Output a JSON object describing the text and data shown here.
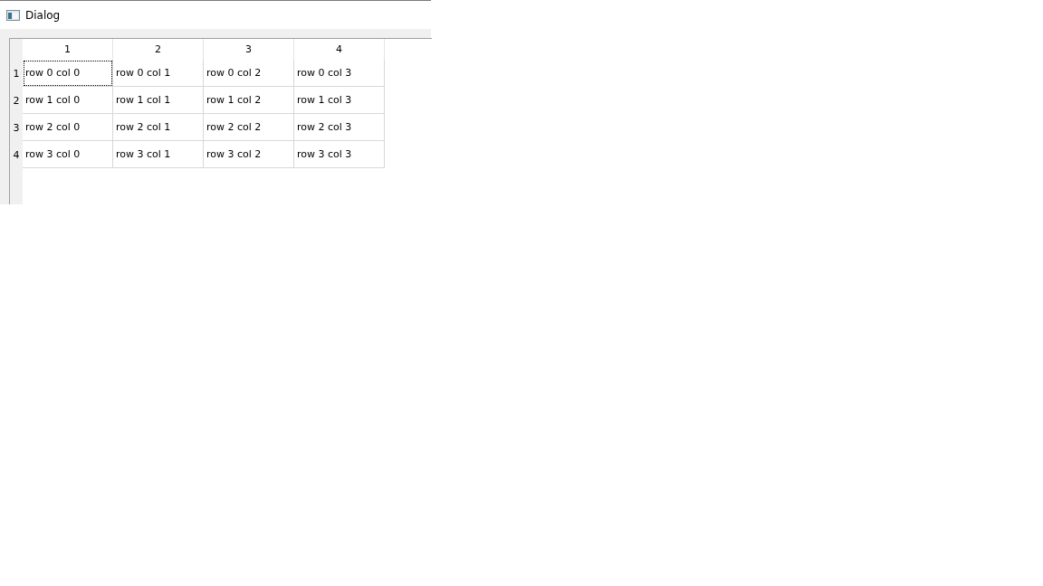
{
  "window": {
    "title": "Dialog"
  },
  "table": {
    "columns": [
      "1",
      "2",
      "3",
      "4"
    ],
    "rows": [
      {
        "header": "1",
        "cells": [
          {
            "text": "row 0 col 0",
            "focused": true
          },
          {
            "text": "row 0 col 1",
            "focused": false
          },
          {
            "text": "row 0 col 2",
            "focused": false
          },
          {
            "text": "row 0 col 3",
            "focused": false
          }
        ]
      },
      {
        "header": "2",
        "cells": [
          {
            "text": "row 1 col 0",
            "focused": false
          },
          {
            "text": "row 1 col 1",
            "focused": false
          },
          {
            "text": "row 1 col 2",
            "focused": false
          },
          {
            "text": "row 1 col 3",
            "focused": false
          }
        ]
      },
      {
        "header": "3",
        "cells": [
          {
            "text": "row 2 col 0",
            "focused": false
          },
          {
            "text": "row 2 col 1",
            "focused": false
          },
          {
            "text": "row 2 col 2",
            "focused": false
          },
          {
            "text": "row 2 col 3",
            "focused": false
          }
        ]
      },
      {
        "header": "4",
        "cells": [
          {
            "text": "row 3 col 0",
            "focused": false
          },
          {
            "text": "row 3 col 1",
            "focused": false
          },
          {
            "text": "row 3 col 2",
            "focused": false
          },
          {
            "text": "row 3 col 3",
            "focused": false
          }
        ]
      }
    ]
  }
}
